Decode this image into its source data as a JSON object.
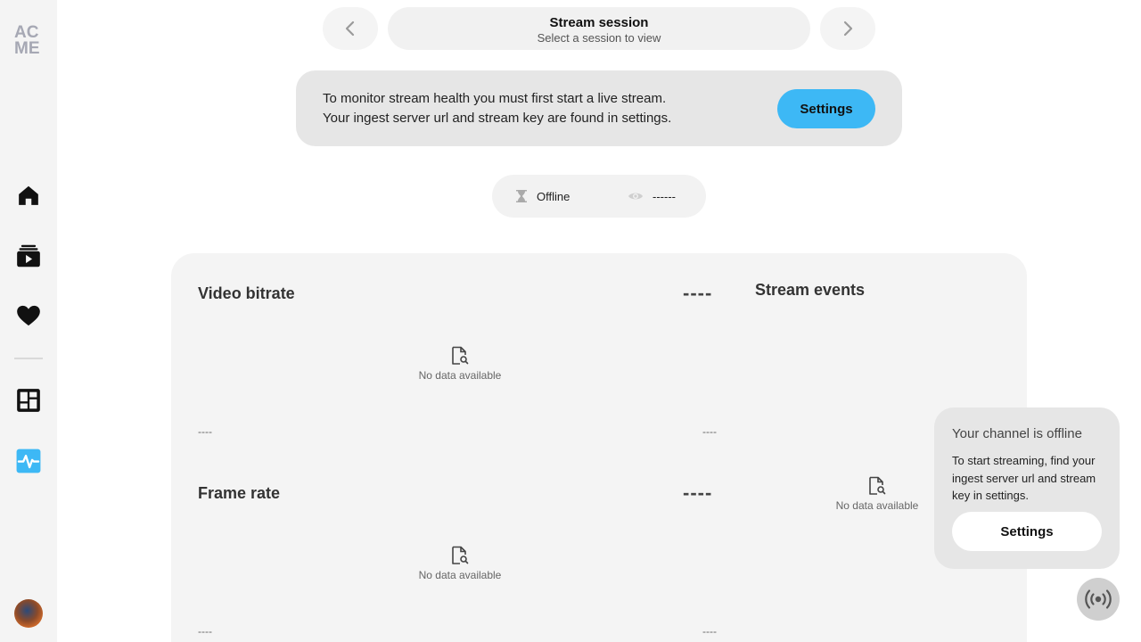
{
  "sidebar": {
    "logo_line1": "AC",
    "logo_line2": "ME",
    "items": [
      {
        "name": "home",
        "icon": "home-icon"
      },
      {
        "name": "videos",
        "icon": "video-library-icon"
      },
      {
        "name": "favorites",
        "icon": "heart-icon"
      },
      {
        "name": "dashboard",
        "icon": "dashboard-icon"
      },
      {
        "name": "stream-health",
        "icon": "pulse-icon",
        "active": true
      }
    ],
    "accent_color": "#3db8f5"
  },
  "session": {
    "title": "Stream session",
    "subtitle": "Select a session to view"
  },
  "banner": {
    "line1": "To monitor stream health you must first start a live stream.",
    "line2": "Your ingest server url and stream key are found in settings.",
    "button_label": "Settings"
  },
  "status": {
    "state": "Offline",
    "viewers": "------"
  },
  "metrics": [
    {
      "title": "Video bitrate",
      "value": "----",
      "empty_text": "No data available",
      "axis_left": "----",
      "axis_right": "----"
    },
    {
      "title": "Frame rate",
      "value": "----",
      "empty_text": "No data available",
      "axis_left": "----",
      "axis_right": "----"
    }
  ],
  "events": {
    "title": "Stream events",
    "empty_text": "No data available"
  },
  "offline_popover": {
    "title": "Your channel is offline",
    "text": "To start streaming, find your ingest server url and stream key in settings.",
    "button_label": "Settings"
  },
  "broadcast_button": {
    "icon": "broadcast-icon"
  }
}
